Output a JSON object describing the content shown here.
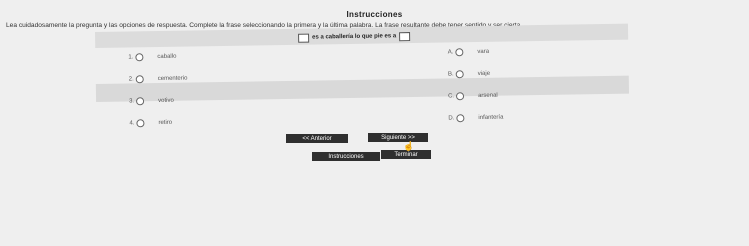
{
  "header": {
    "title": "Instrucciones"
  },
  "instructions_text": "Lea cuidadosamente la pregunta y las opciones de respuesta. Complete la frase seleccionando la primera y la última palabra. La frase resultante debe tener sentido y ser cierta.",
  "question": {
    "stem": "es a caballería lo que pie es a"
  },
  "left_options": [
    {
      "num": "1.",
      "label": "caballo"
    },
    {
      "num": "2.",
      "label": "cementerio"
    },
    {
      "num": "3.",
      "label": "votivo"
    },
    {
      "num": "4.",
      "label": "retiro"
    }
  ],
  "right_options": [
    {
      "letter": "A.",
      "label": "vara"
    },
    {
      "letter": "B.",
      "label": "viaje"
    },
    {
      "letter": "C.",
      "label": "arsenal"
    },
    {
      "letter": "D.",
      "label": "infantería"
    }
  ],
  "buttons": {
    "previous": "<< Anterior",
    "next": "Siguiente >>",
    "instructions": "Instrucciones",
    "finish": "Terminar"
  }
}
